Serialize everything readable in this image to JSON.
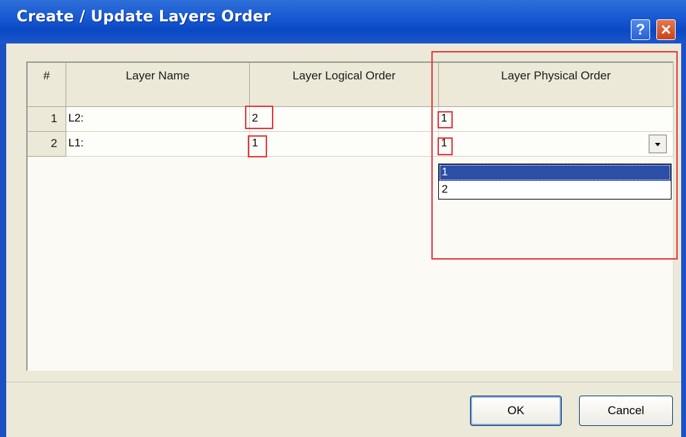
{
  "window": {
    "title": "Create / Update Layers Order"
  },
  "titlebar": {
    "help_label": "?",
    "close_label": "✕"
  },
  "grid": {
    "columns": [
      "#",
      "Layer Name",
      "Layer Logical Order",
      "Layer Physical Order"
    ],
    "rows": [
      {
        "num": "1",
        "name": "L2:",
        "logical": "2",
        "physical": "1"
      },
      {
        "num": "2",
        "name": "L1:",
        "logical": "1",
        "physical": "1"
      }
    ],
    "dropdown_options": [
      "1",
      "2"
    ],
    "dropdown_selected": "1"
  },
  "buttons": {
    "ok": "OK",
    "cancel": "Cancel"
  },
  "icons": {
    "help": "help-icon",
    "close": "close-icon",
    "dropdown": "chevron-down-icon"
  }
}
